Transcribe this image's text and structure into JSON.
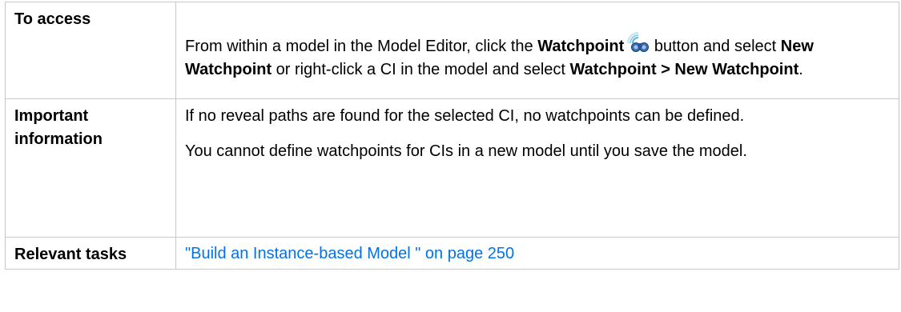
{
  "table": {
    "access": {
      "label": "To access",
      "text_1": "From within a model in the Model Editor, click the ",
      "bold_1": "Watchpoint",
      "text_2": " button and select ",
      "bold_2": "New Watchpoint",
      "text_3": " or right-click a CI in the model and select ",
      "bold_3": "Watchpoint > New Watchpoint",
      "text_4": ".",
      "icon": "watchpoint-binoculars-icon"
    },
    "important": {
      "label": "Important information",
      "paragraph_1": "If no reveal paths are found for the selected CI, no watchpoints can be defined.",
      "paragraph_2": "You cannot define watchpoints for CIs in a new model until you save the model."
    },
    "tasks": {
      "label": "Relevant tasks",
      "link_text": "\"Build an Instance-based Model \" on page 250"
    }
  },
  "colors": {
    "border": "#c8c8c8",
    "link": "#0073e7",
    "text": "#000000"
  }
}
